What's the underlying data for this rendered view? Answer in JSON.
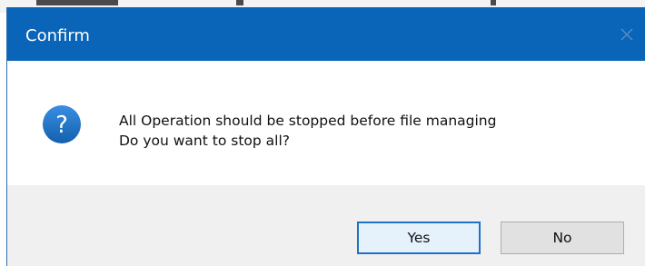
{
  "dialog": {
    "title": "Confirm",
    "message_lines": [
      "All Operation should be stopped before file managing",
      "Do you want to stop all?"
    ],
    "icon": "question-icon",
    "buttons": {
      "yes_label": "Yes",
      "no_label": "No"
    }
  },
  "colors": {
    "titlebar": "#0a64b8",
    "title_text": "#ffffff",
    "footer": "#f0f0f0",
    "default_button_border": "#1f72c8",
    "icon_fill": "#1a73c9"
  }
}
